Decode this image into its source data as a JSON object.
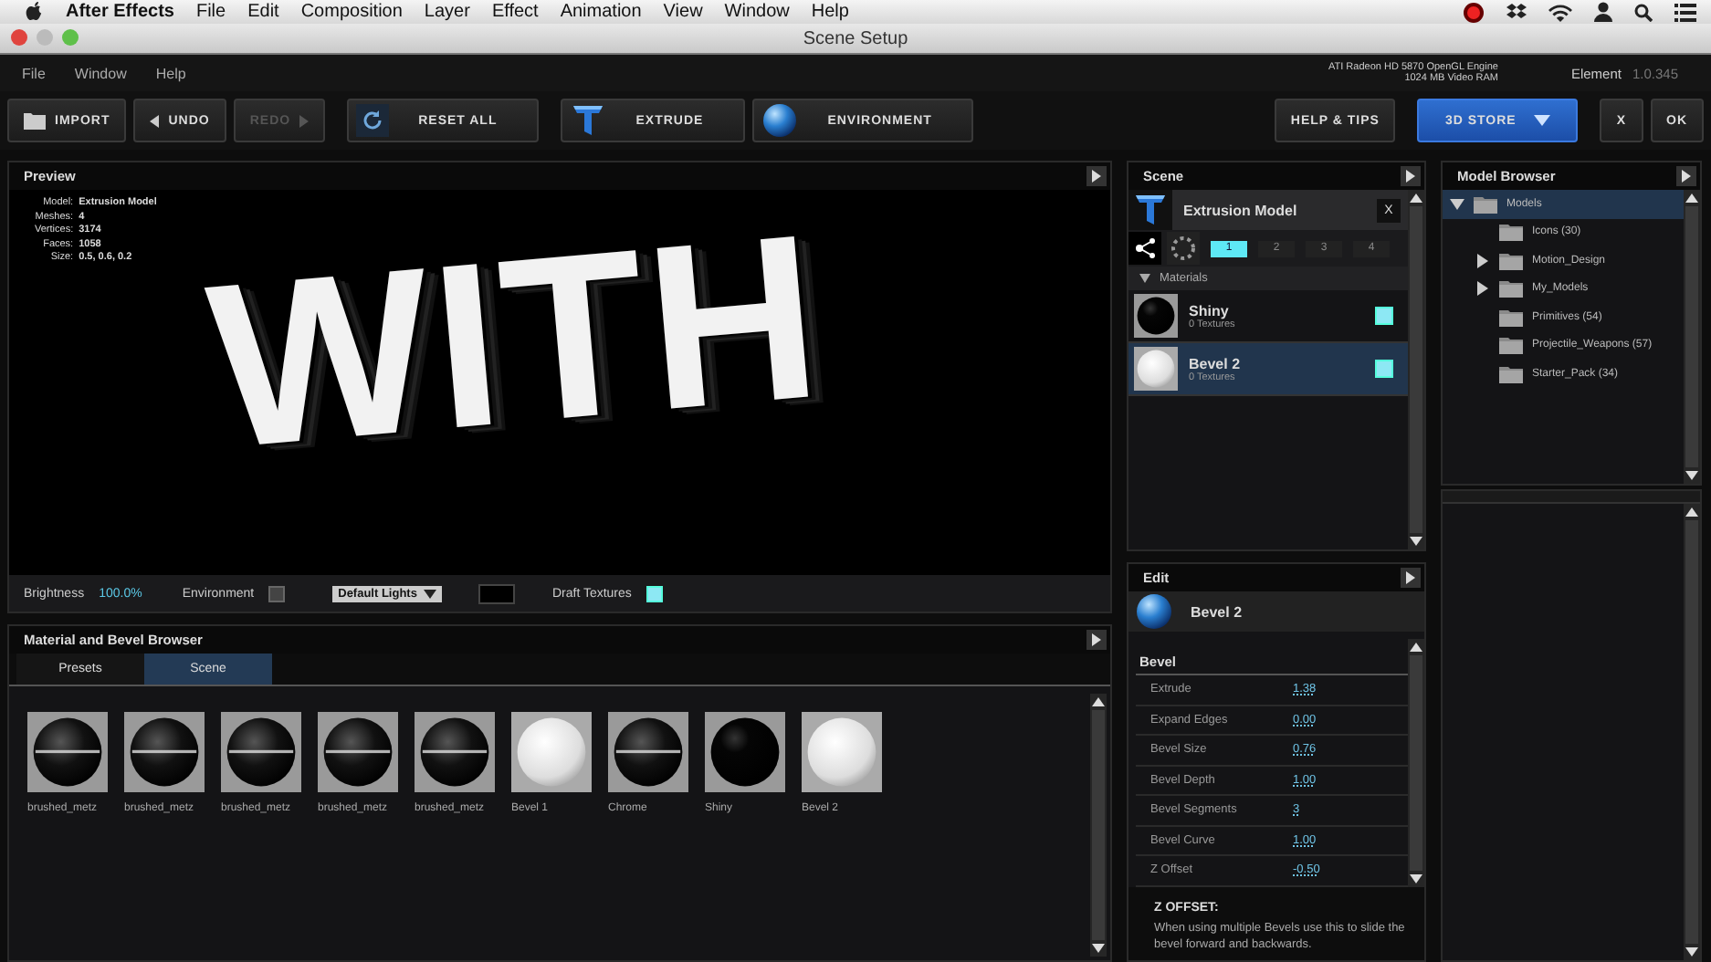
{
  "menubar": {
    "app": "After Effects",
    "items": [
      "File",
      "Edit",
      "Composition",
      "Layer",
      "Effect",
      "Animation",
      "View",
      "Window",
      "Help"
    ]
  },
  "window": {
    "title": "Scene Setup"
  },
  "app_menu": [
    "File",
    "Window",
    "Help"
  ],
  "gpu_info": [
    "ATI Radeon HD 5870 OpenGL Engine",
    "1024 MB Video RAM"
  ],
  "product": {
    "name": "Element",
    "version": "1.0.345"
  },
  "toolbar": {
    "left": [
      [
        {
          "label": "IMPORT",
          "kind": "folder",
          "disabled": false
        },
        {
          "label": "UNDO",
          "kind": "back",
          "disabled": false
        },
        {
          "label": "REDO",
          "kind": "forward",
          "disabled": true
        }
      ],
      [
        {
          "label": "RESET ALL",
          "kind": "reset",
          "disabled": false
        }
      ],
      [
        {
          "label": "EXTRUDE",
          "kind": "extrude",
          "disabled": false
        },
        {
          "label": "ENVIRONMENT",
          "kind": "sphere",
          "disabled": false
        }
      ]
    ],
    "right": [
      [
        {
          "label": "HELP & TIPS",
          "kind": "plain",
          "disabled": false
        }
      ],
      [
        {
          "label": "3D STORE",
          "kind": "dropdown",
          "disabled": false
        }
      ],
      [
        {
          "label": "X",
          "kind": "plain",
          "disabled": false
        },
        {
          "label": "OK",
          "kind": "plain",
          "disabled": false
        }
      ]
    ]
  },
  "preview": {
    "title": "Preview",
    "stats": [
      {
        "label": "Model:",
        "value": "Extrusion Model"
      },
      {
        "label": "Meshes:",
        "value": "4"
      },
      {
        "label": "Vertices:",
        "value": "3174"
      },
      {
        "label": "Faces:",
        "value": "1058"
      },
      {
        "label": "Size:",
        "value": "0.5, 0.6, 0.2"
      }
    ],
    "render_text": "WITH",
    "brightness": {
      "label": "Brightness",
      "value": "100.0%"
    },
    "environment": {
      "label": "Environment",
      "checked": false
    },
    "lights": {
      "value": "Default Lights"
    },
    "draft_textures": {
      "label": "Draft Textures",
      "checked": true
    }
  },
  "material_browser": {
    "title": "Material and Bevel Browser",
    "tabs": [
      {
        "label": "Presets",
        "selected": false
      },
      {
        "label": "Scene",
        "selected": true
      }
    ],
    "items": [
      {
        "name": "brushed_metz",
        "kind": "glossy"
      },
      {
        "name": "brushed_metz",
        "kind": "glossy"
      },
      {
        "name": "brushed_metz",
        "kind": "glossy"
      },
      {
        "name": "brushed_metz",
        "kind": "glossy"
      },
      {
        "name": "brushed_metz",
        "kind": "glossy"
      },
      {
        "name": "Bevel 1",
        "kind": "matte"
      },
      {
        "name": "Chrome",
        "kind": "glossy"
      },
      {
        "name": "Shiny",
        "kind": "black"
      },
      {
        "name": "Bevel 2",
        "kind": "matte"
      }
    ]
  },
  "scene": {
    "title": "Scene",
    "model": "Extrusion Model",
    "close": "X",
    "groups": [
      {
        "label": "1",
        "selected": true
      },
      {
        "label": "2",
        "selected": false
      },
      {
        "label": "3",
        "selected": false
      },
      {
        "label": "4",
        "selected": false
      }
    ],
    "materials_header": "Materials",
    "materials": [
      {
        "name": "Shiny",
        "sub": "0 Textures",
        "kind": "black",
        "selected": false,
        "checked": true
      },
      {
        "name": "Bevel 2",
        "sub": "0 Textures",
        "kind": "matte",
        "selected": true,
        "checked": true
      }
    ]
  },
  "edit": {
    "title": "Edit",
    "material": "Bevel 2",
    "section": "Bevel",
    "params": [
      {
        "label": "Extrude",
        "value": "1.38"
      },
      {
        "label": "Expand Edges",
        "value": "0.00"
      },
      {
        "label": "Bevel Size",
        "value": "0.76"
      },
      {
        "label": "Bevel Depth",
        "value": "1.00"
      },
      {
        "label": "Bevel Segments",
        "value": "3"
      },
      {
        "label": "Bevel Curve",
        "value": "1.00"
      },
      {
        "label": "Z Offset",
        "value": "-0.50"
      }
    ],
    "help_title": "Z OFFSET:",
    "help_text": "When using multiple Bevels use this to slide the bevel forward and backwards."
  },
  "model_browser": {
    "title": "Model Browser",
    "tree": [
      {
        "label": "Models",
        "expanded": true,
        "selected": true,
        "children": [
          {
            "label": "Icons (30)",
            "selected": false
          },
          {
            "label": "Motion_Design",
            "expanded": false,
            "selected": false
          },
          {
            "label": "My_Models",
            "expanded": false,
            "selected": false
          },
          {
            "label": "Primitives (54)",
            "selected": false
          },
          {
            "label": "Projectile_Weapons (57)",
            "selected": false
          },
          {
            "label": "Starter_Pack (34)",
            "selected": false
          }
        ]
      }
    ]
  }
}
